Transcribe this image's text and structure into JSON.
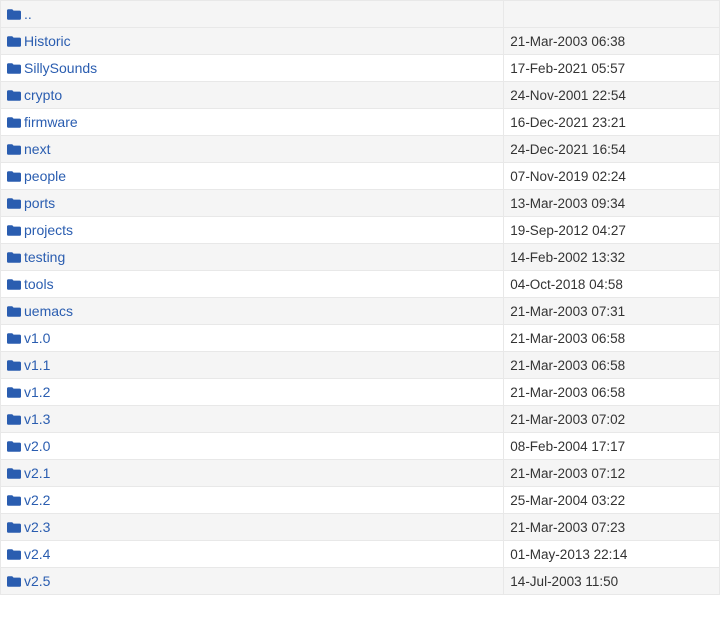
{
  "listing": {
    "entries": [
      {
        "name": "..",
        "date": ""
      },
      {
        "name": "Historic",
        "date": "21-Mar-2003 06:38"
      },
      {
        "name": "SillySounds",
        "date": "17-Feb-2021 05:57"
      },
      {
        "name": "crypto",
        "date": "24-Nov-2001 22:54"
      },
      {
        "name": "firmware",
        "date": "16-Dec-2021 23:21"
      },
      {
        "name": "next",
        "date": "24-Dec-2021 16:54"
      },
      {
        "name": "people",
        "date": "07-Nov-2019 02:24"
      },
      {
        "name": "ports",
        "date": "13-Mar-2003 09:34"
      },
      {
        "name": "projects",
        "date": "19-Sep-2012 04:27"
      },
      {
        "name": "testing",
        "date": "14-Feb-2002 13:32"
      },
      {
        "name": "tools",
        "date": "04-Oct-2018 04:58"
      },
      {
        "name": "uemacs",
        "date": "21-Mar-2003 07:31"
      },
      {
        "name": "v1.0",
        "date": "21-Mar-2003 06:58"
      },
      {
        "name": "v1.1",
        "date": "21-Mar-2003 06:58"
      },
      {
        "name": "v1.2",
        "date": "21-Mar-2003 06:58"
      },
      {
        "name": "v1.3",
        "date": "21-Mar-2003 07:02"
      },
      {
        "name": "v2.0",
        "date": "08-Feb-2004 17:17"
      },
      {
        "name": "v2.1",
        "date": "21-Mar-2003 07:12"
      },
      {
        "name": "v2.2",
        "date": "25-Mar-2004 03:22"
      },
      {
        "name": "v2.3",
        "date": "21-Mar-2003 07:23"
      },
      {
        "name": "v2.4",
        "date": "01-May-2013 22:14"
      },
      {
        "name": "v2.5",
        "date": "14-Jul-2003 11:50"
      }
    ]
  }
}
